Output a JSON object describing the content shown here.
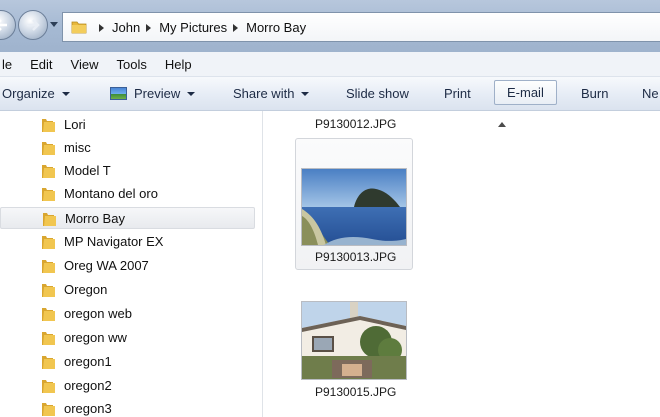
{
  "address_bar": {
    "breadcrumbs": [
      "John",
      "My Pictures",
      "Morro Bay"
    ]
  },
  "menu": {
    "items": [
      "le",
      "Edit",
      "View",
      "Tools",
      "Help"
    ]
  },
  "command_bar": {
    "organize": "Organize",
    "preview": "Preview",
    "share_with": "Share with",
    "slide_show": "Slide show",
    "print": "Print",
    "email": "E-mail",
    "burn": "Burn",
    "new": "Ne"
  },
  "nav_tree": {
    "items": [
      "Lori",
      "misc",
      "Model T",
      "Montano del oro",
      "Morro Bay",
      "MP Navigator EX",
      "Oreg WA 2007",
      "Oregon",
      "oregon web",
      "oregon ww",
      "oregon1",
      "oregon2",
      "oregon3"
    ],
    "selected": "Morro Bay"
  },
  "files": [
    {
      "name": "P9130012.JPG"
    },
    {
      "name": "P9130013.JPG"
    },
    {
      "name": "P9130015.JPG"
    }
  ],
  "icons": {
    "back": "back-arrow-icon",
    "forward": "forward-arrow-icon",
    "folder": "folder-icon",
    "preview": "image-preview-icon"
  },
  "colors": {
    "address_bar": "#a5b9d3",
    "command_bar": "#e7edf6",
    "folder": "#e7b73c",
    "selection": "#e8eaee"
  }
}
